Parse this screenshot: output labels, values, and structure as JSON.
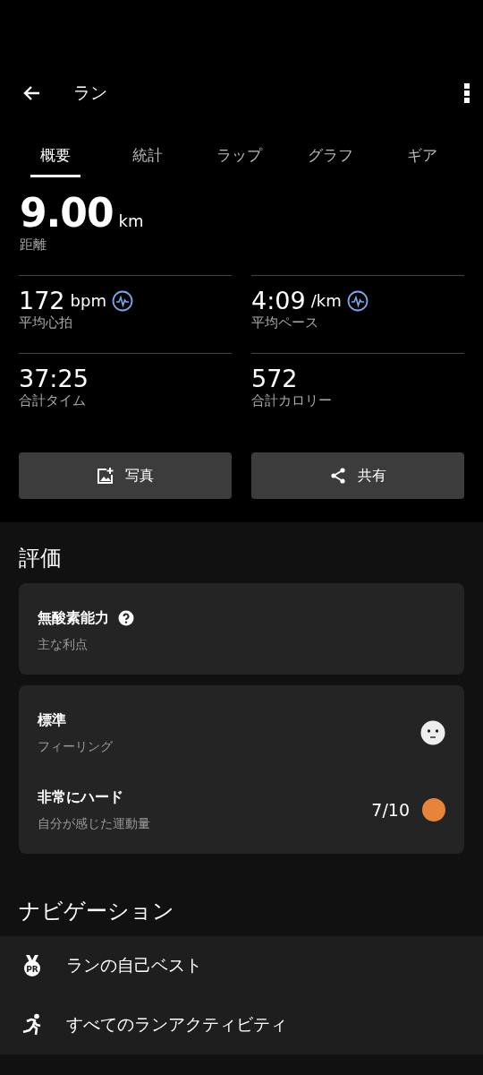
{
  "app_bar": {
    "title": "ラン"
  },
  "tabs": [
    {
      "label": "概要",
      "selected": true
    },
    {
      "label": "統計",
      "selected": false
    },
    {
      "label": "ラップ",
      "selected": false
    },
    {
      "label": "グラフ",
      "selected": false
    },
    {
      "label": "ギア",
      "selected": false
    }
  ],
  "distance": {
    "value": "9.00",
    "unit": "km",
    "label": "距離"
  },
  "stats": [
    {
      "value": "172",
      "unit": "bpm",
      "label": "平均心拍",
      "graph_icon": true
    },
    {
      "value": "4:09",
      "unit": "/km",
      "label": "平均ペース",
      "graph_icon": true
    },
    {
      "value": "37:25",
      "label": "合計タイム",
      "graph_icon": false
    },
    {
      "value": "572",
      "label": "合計カロリー",
      "graph_icon": false
    }
  ],
  "buttons": [
    {
      "kind": "photo",
      "label": "写真"
    },
    {
      "kind": "share",
      "label": "共有"
    }
  ],
  "rating": {
    "heading": "評価",
    "cards": [
      {
        "rows": [
          {
            "kind": "info",
            "title": "無酸素能力",
            "subtitle": "主な利点"
          }
        ]
      },
      {
        "rows": [
          {
            "kind": "feeling",
            "title": "標準",
            "subtitle": "フィーリング"
          },
          {
            "kind": "effort",
            "title": "非常にハード",
            "subtitle": "自分が感じた運動量",
            "score": "7/10",
            "color": "#e8833a"
          }
        ]
      }
    ]
  },
  "navigation": {
    "heading": "ナビゲーション",
    "items": [
      {
        "kind": "records",
        "label": "ランの自己ベスト",
        "icon_text": "PR"
      },
      {
        "kind": "activities",
        "label": "すべてのランアクティビティ"
      }
    ]
  }
}
